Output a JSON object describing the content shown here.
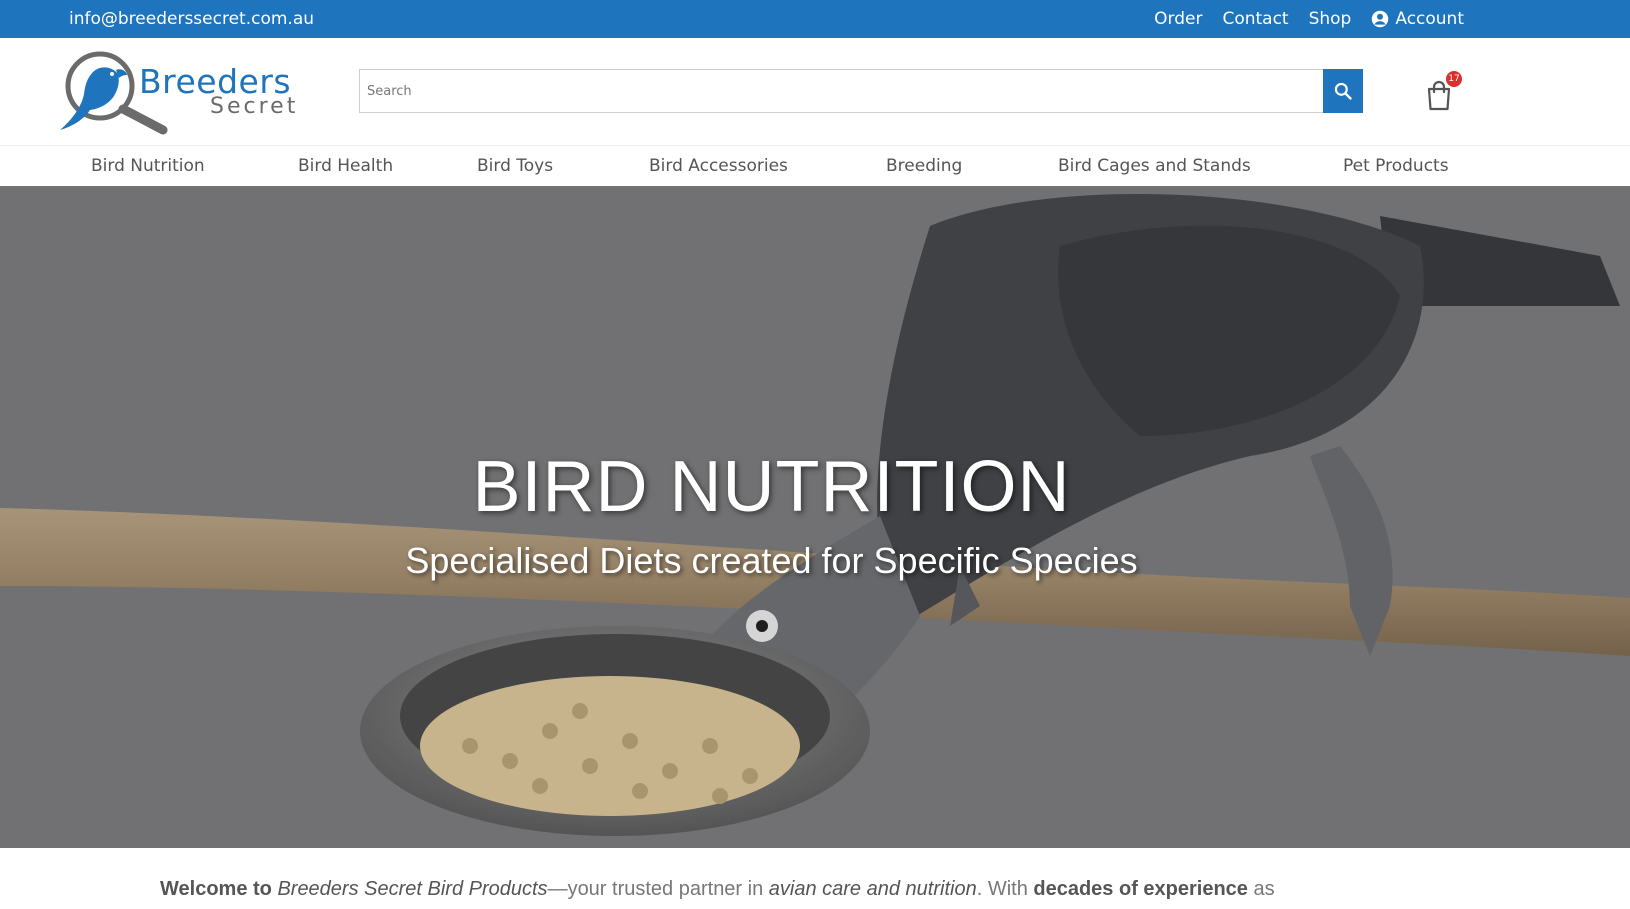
{
  "topbar": {
    "email": "info@breederssecret.com.au",
    "links": {
      "order": "Order",
      "contact": "Contact",
      "shop": "Shop",
      "account": "Account"
    }
  },
  "logo": {
    "word1": "Breeders",
    "word2": "Secret"
  },
  "search": {
    "placeholder": "Search"
  },
  "cart": {
    "count": "17"
  },
  "categories": [
    "Bird Nutrition",
    "Bird Health",
    "Bird Toys",
    "Bird Accessories",
    "Breeding",
    "Bird Cages and Stands",
    "Pet Products"
  ],
  "hero": {
    "title": "BIRD NUTRITION",
    "subtitle": "Specialised Diets created for Specific Species"
  },
  "welcome": {
    "p1": "Welcome to ",
    "p2": "Breeders Secret Bird Products",
    "p3": "—your trusted partner in ",
    "p4": "avian care and nutrition",
    "p5": ". With ",
    "p6": "decades of experience",
    "p7": " as"
  },
  "colors": {
    "brand": "#1e74bd",
    "badge": "#d9302c"
  },
  "icons": {
    "account": "account-icon",
    "search": "search-icon",
    "cart": "cart-icon"
  }
}
